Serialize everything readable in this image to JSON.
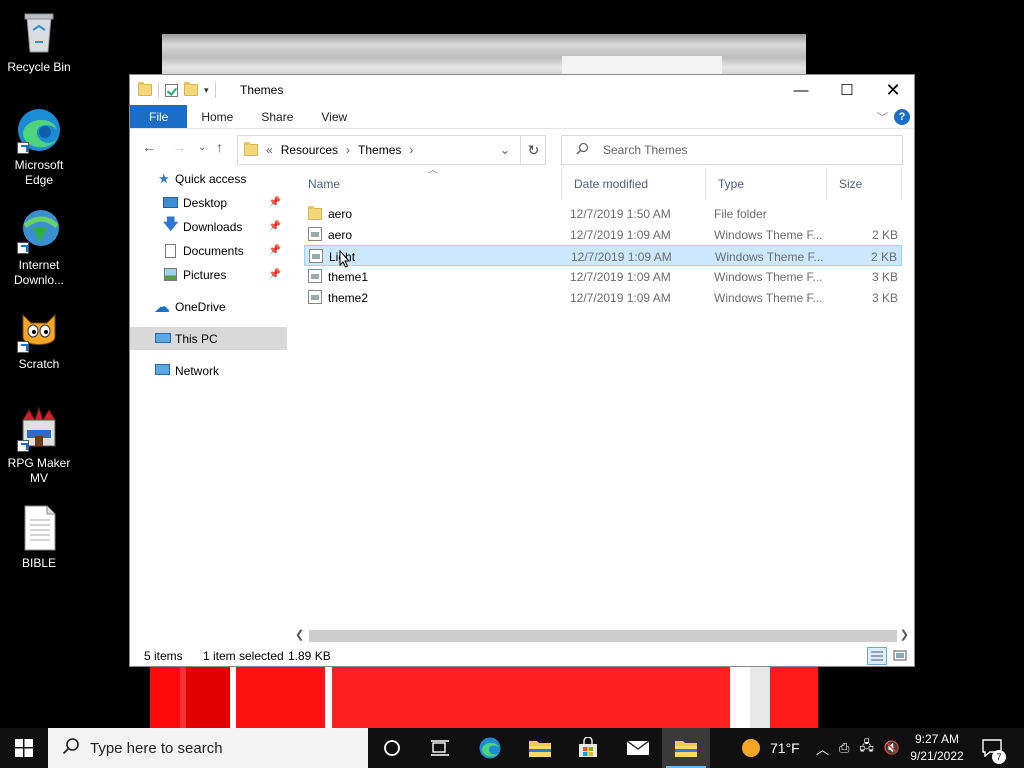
{
  "desktop": {
    "icons": [
      {
        "label": "Recycle Bin"
      },
      {
        "label": "Microsoft Edge"
      },
      {
        "label": "Internet Downlo..."
      },
      {
        "label": "Scratch"
      },
      {
        "label": "RPG Maker MV"
      },
      {
        "label": "BIBLE"
      }
    ]
  },
  "window": {
    "title": "Themes",
    "ribbon_tabs": [
      "File",
      "Home",
      "Share",
      "View"
    ],
    "breadcrumb": {
      "prefix": "«",
      "items": [
        "Resources",
        "Themes"
      ]
    },
    "search_placeholder": "Search Themes",
    "sidebar": {
      "quick_access": "Quick access",
      "items": [
        {
          "label": "Desktop",
          "pinned": true
        },
        {
          "label": "Downloads",
          "pinned": true
        },
        {
          "label": "Documents",
          "pinned": true
        },
        {
          "label": "Pictures",
          "pinned": true
        }
      ],
      "onedrive": "OneDrive",
      "this_pc": "This PC",
      "network": "Network"
    },
    "columns": [
      "Name",
      "Date modified",
      "Type",
      "Size"
    ],
    "files": [
      {
        "name": "aero",
        "date": "12/7/2019 1:50 AM",
        "type": "File folder",
        "size": "",
        "icon": "folder-icon"
      },
      {
        "name": "aero",
        "date": "12/7/2019 1:09 AM",
        "type": "Windows Theme F...",
        "size": "2 KB",
        "icon": "theme-file-icon"
      },
      {
        "name": "Light",
        "date": "12/7/2019 1:09 AM",
        "type": "Windows Theme F...",
        "size": "2 KB",
        "icon": "theme-file-icon",
        "selected": true
      },
      {
        "name": "theme1",
        "date": "12/7/2019 1:09 AM",
        "type": "Windows Theme F...",
        "size": "3 KB",
        "icon": "theme-file-icon"
      },
      {
        "name": "theme2",
        "date": "12/7/2019 1:09 AM",
        "type": "Windows Theme F...",
        "size": "3 KB",
        "icon": "theme-file-icon"
      }
    ],
    "status": {
      "count": "5 items",
      "selection": "1 item selected",
      "size": "1.89 KB"
    }
  },
  "taskbar": {
    "search_placeholder": "Type here to search",
    "weather": "71°F",
    "time": "9:27 AM",
    "date": "9/21/2022",
    "notification_count": "7"
  },
  "colors": {
    "accent": "#1a6ec7",
    "selection": "#cce8ff",
    "taskbar": "#101010"
  }
}
